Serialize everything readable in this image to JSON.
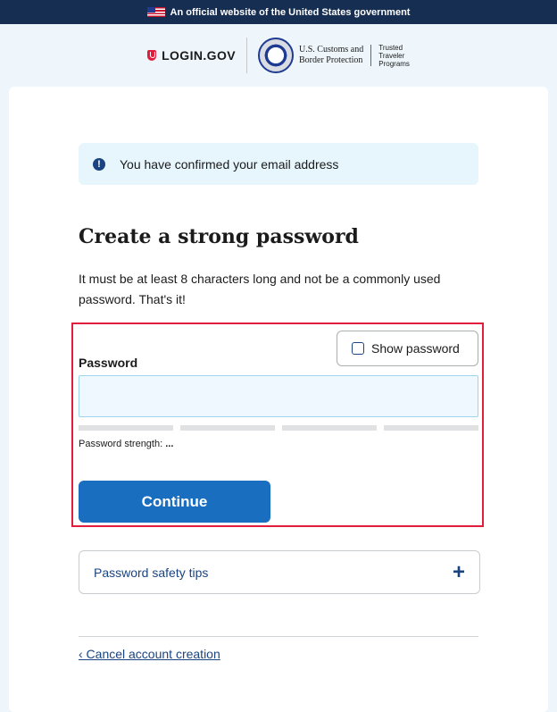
{
  "banner": {
    "text": "An official website of the United States government"
  },
  "header": {
    "logo_text": "LOGIN.GOV",
    "agency_name_line1": "U.S. Customs and",
    "agency_name_line2": "Border Protection",
    "program_line1": "Trusted",
    "program_line2": "Traveler",
    "program_line3": "Programs"
  },
  "alert": {
    "icon": "info-icon",
    "text": "You have confirmed your email address"
  },
  "main": {
    "title": "Create a strong password",
    "description": "It must be at least 8 characters long and not be a commonly used password. That's it!"
  },
  "form": {
    "show_password_label": "Show password",
    "password_label": "Password",
    "password_value": "",
    "strength_label": "Password strength:",
    "strength_value": "...",
    "continue_label": "Continue"
  },
  "tips": {
    "label": "Password safety tips",
    "icon": "plus-icon"
  },
  "footer": {
    "cancel_link": "‹ Cancel account creation"
  },
  "colors": {
    "banner_bg": "#162e51",
    "primary": "#1a6ebf",
    "link": "#1a4480",
    "highlight_border": "#e21c3d",
    "page_bg": "#eef6fb",
    "alert_bg": "#e7f6fd"
  }
}
